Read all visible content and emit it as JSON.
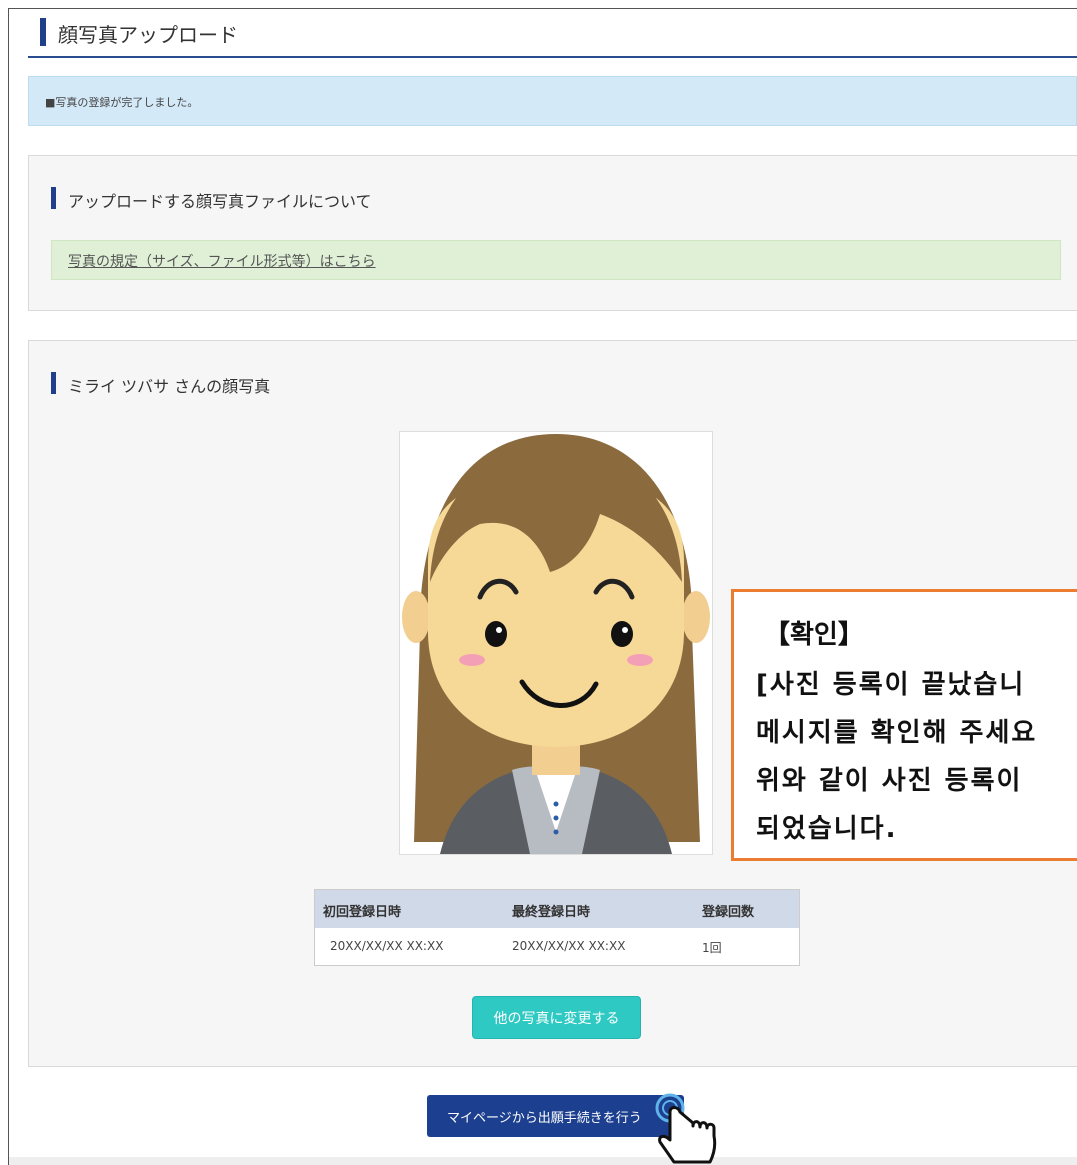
{
  "header": {
    "title": "顔写真アップロード"
  },
  "notice": {
    "text": "■写真の登録が完了しました。"
  },
  "upload_info": {
    "title": "アップロードする顔写真ファイルについて",
    "link": "写真の規定（サイズ、ファイル形式等）はこちら"
  },
  "photo_section": {
    "title": "ミライ ツバサ さんの顔写真",
    "table": {
      "headers": [
        "初回登録日時",
        "最終登録日時",
        "登録回数"
      ],
      "row": [
        "20XX/XX/XX XX:XX",
        "20XX/XX/XX XX:XX",
        "1回"
      ]
    },
    "change_button": "他の写真に変更する"
  },
  "mypage_button": "マイページから出願手続きを行う",
  "callout": {
    "title": "【확인】",
    "lines": [
      "[사진 등록이 끝났습니",
      "메시지를 확인해 주세요",
      "위와 같이 사진 등록이",
      "되었습니다."
    ]
  },
  "colors": {
    "accent_navy": "#1f3f8a",
    "notice_blue": "#d4e9f7",
    "link_green": "#dff0d6",
    "button_teal": "#2ec9c3",
    "callout_orange": "#ec7c30"
  }
}
